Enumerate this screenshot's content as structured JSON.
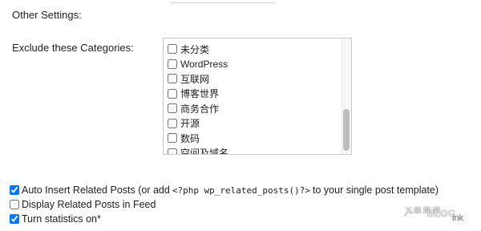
{
  "settings": {
    "section_title": "Other Settings:",
    "exclude_label": "Exclude these Categories:",
    "categories": [
      {
        "label": "未分类",
        "checked": false
      },
      {
        "label": "WordPress",
        "checked": false
      },
      {
        "label": "互联网",
        "checked": false
      },
      {
        "label": "博客世界",
        "checked": false
      },
      {
        "label": "商务合作",
        "checked": false
      },
      {
        "label": "开源",
        "checked": false
      },
      {
        "label": "数码",
        "checked": false
      },
      {
        "label": "空间及域名",
        "checked": false
      }
    ],
    "options": [
      {
        "label_pre": "Auto Insert Related Posts (or add ",
        "code": "<?php wp_related_posts()?>",
        "label_post": " to your single post template)",
        "checked": true
      },
      {
        "label": "Display Related Posts in Feed",
        "checked": false
      },
      {
        "label": "Turn statistics on*",
        "checked": true
      }
    ]
  },
  "watermark": {
    "top": "ꭘ⊠⊠⊠",
    "main": "BLOG",
    "tail": "ink"
  }
}
